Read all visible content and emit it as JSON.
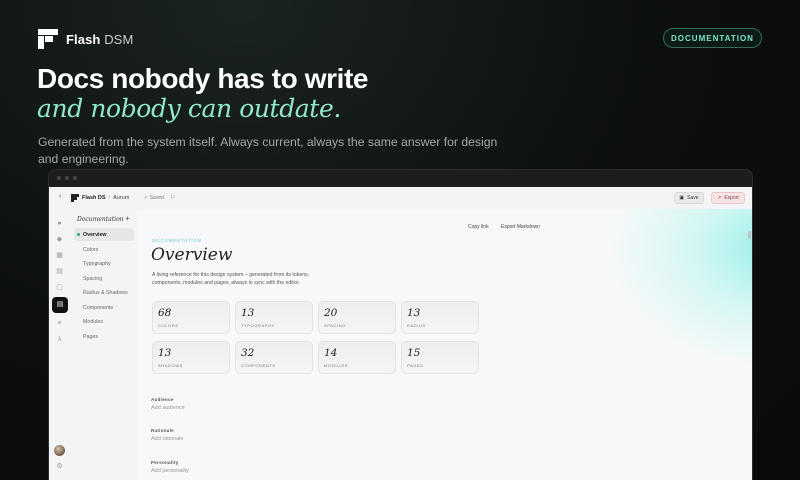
{
  "brand": {
    "name": "Flash",
    "suffix": "DSM"
  },
  "badge": "DOCUMENTATION",
  "hero": {
    "title": "Docs nobody has to write",
    "title_italic": "and nobody can outdate.",
    "subtitle": "Generated from the system itself. Always current, always the same answer for design and engineering."
  },
  "app": {
    "breadcrumb": {
      "brand": "Flash DS",
      "separator": "/",
      "project": "Aurum"
    },
    "saved_status": "Saved",
    "save_label": "Save",
    "export_label": "Export",
    "nav": {
      "title": "Documentation",
      "add": "+",
      "items": [
        {
          "label": "Overview"
        },
        {
          "label": "Colors"
        },
        {
          "label": "Typography"
        },
        {
          "label": "Spacing"
        },
        {
          "label": "Radius & Shadows"
        },
        {
          "label": "Components"
        },
        {
          "label": "Modules"
        },
        {
          "label": "Pages"
        }
      ]
    },
    "main": {
      "copy_link": "Copy link",
      "export_markdown": "Export Markdown",
      "kicker": "DOCUMENTATION",
      "title": "Overview",
      "description": "A living reference for this design system – generated from its tokens, components, modules and pages, always in sync with the editor.",
      "stats": [
        {
          "value": "68",
          "label": "COLORS"
        },
        {
          "value": "13",
          "label": "TYPOGRAPHY"
        },
        {
          "value": "20",
          "label": "SPACING"
        },
        {
          "value": "13",
          "label": "RADIUS"
        },
        {
          "value": "13",
          "label": "SHADOWS"
        },
        {
          "value": "32",
          "label": "COMPONENTS"
        },
        {
          "value": "14",
          "label": "MODULES"
        },
        {
          "value": "15",
          "label": "PAGES"
        }
      ],
      "fields": [
        {
          "label": "Audience",
          "placeholder": "Add audience"
        },
        {
          "label": "Rationale",
          "placeholder": "Add rationale"
        },
        {
          "label": "Personality",
          "placeholder": "Add personality"
        }
      ]
    }
  },
  "colors": {
    "accent": "#8fe8cd",
    "badge_text": "#79e6c8",
    "background": "#0c0e0f"
  }
}
